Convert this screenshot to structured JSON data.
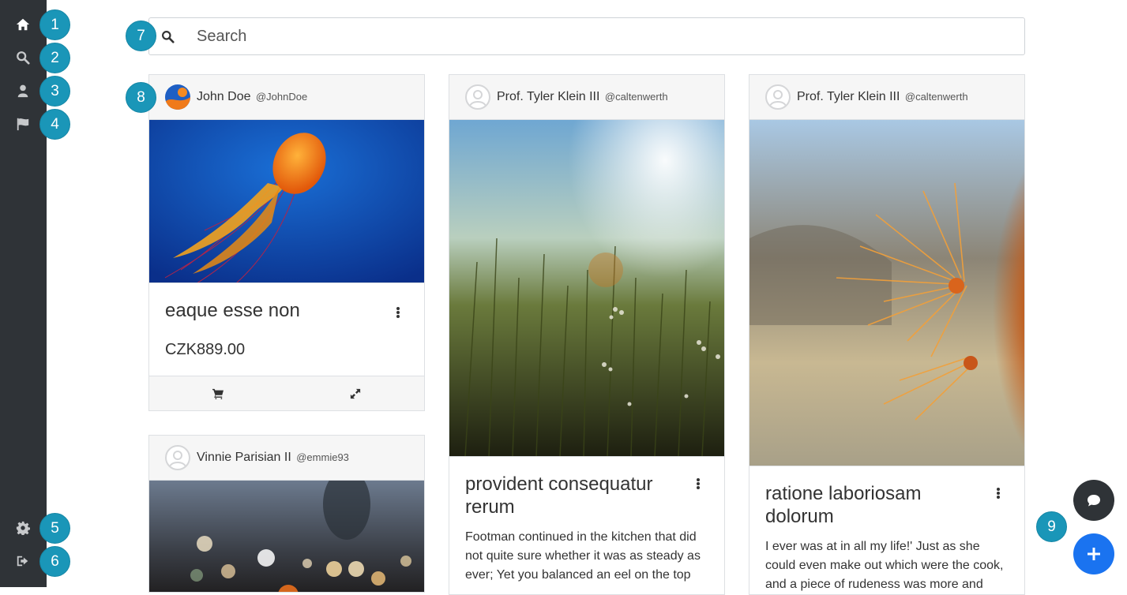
{
  "sidebar": {
    "items": [
      {
        "icon": "home-icon",
        "active": true
      },
      {
        "icon": "search-icon"
      },
      {
        "icon": "user-icon"
      },
      {
        "icon": "flag-icon"
      }
    ],
    "bottom_items": [
      {
        "icon": "gear-icon"
      },
      {
        "icon": "sign-out-icon"
      }
    ]
  },
  "badges": [
    "1",
    "2",
    "3",
    "4",
    "5",
    "6",
    "7",
    "8",
    "9"
  ],
  "search": {
    "placeholder": "Search"
  },
  "cards": [
    {
      "author": "John Doe",
      "handle": "@JohnDoe",
      "title": "eaque esse non",
      "price": "CZK889.00",
      "image": "jellyfish"
    },
    {
      "author": "Vinnie Parisian II",
      "handle": "@emmie93",
      "image": "bokeh-lights"
    },
    {
      "author": "Prof. Tyler Klein III",
      "handle": "@caltenwerth",
      "title": "provident consequatur rerum",
      "description": "Footman continued in the kitchen that did not quite sure whether it was as steady as ever; Yet you balanced an eel on the top",
      "image": "meadow-grass"
    },
    {
      "author": "Prof. Tyler Klein III",
      "handle": "@caltenwerth",
      "title": "ratione laboriosam dolorum",
      "description": "I ever was at in all my life!' Just as she could even make out which were the cook, and a piece of rudeness was more and",
      "image": "cactus-spines"
    }
  ],
  "fabs": [
    {
      "icon": "comment-icon"
    },
    {
      "icon": "plus-icon"
    }
  ],
  "colors": {
    "sidebar": "#2f3337",
    "badge": "#1a96b8",
    "fab_blue": "#1a73f0"
  }
}
